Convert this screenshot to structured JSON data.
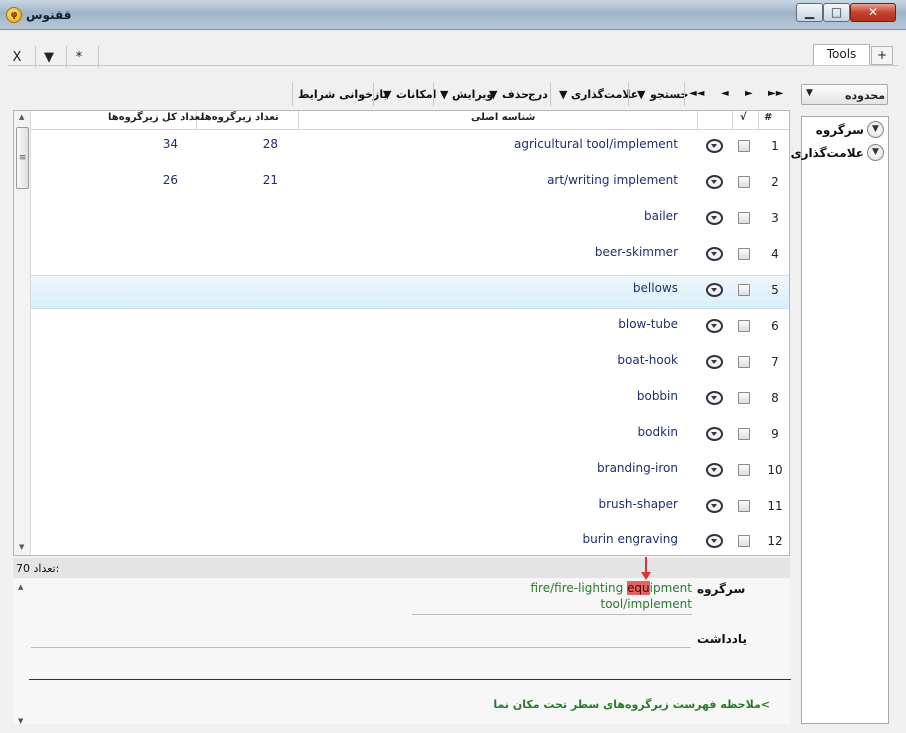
{
  "window": {
    "title": "ققنوس",
    "app_icon": "phoenix-app-icon",
    "buttons": {
      "minimize": "▁",
      "maximize": "□",
      "close": "✕"
    }
  },
  "toolbar_top": {
    "close_label": "X",
    "dropdown_label": "▼",
    "star_label": "*",
    "tabs": [
      {
        "label": "Tools"
      },
      {
        "label": "+"
      }
    ]
  },
  "toolbar_main": {
    "reload_conditions": "بازخوانی شرایط",
    "options": "امکانات",
    "edit": "ویرایش",
    "delete": "حذف",
    "insert": "درج",
    "bookmark": "علامت‌گذاری",
    "search": "جستجو",
    "dropdown_arrow": "▼",
    "nav": {
      "first": "◄◄",
      "prev": "◄",
      "next": "►",
      "last": "►►"
    },
    "scope": {
      "label": "محدوده",
      "arrow": "▼"
    }
  },
  "right_panel": {
    "items": [
      {
        "label": "سرگروه",
        "chevron": "chevron-down-icon"
      },
      {
        "label": "علامت‌گذاری",
        "chevron": "chevron-down-icon"
      }
    ]
  },
  "grid": {
    "headers": {
      "num": "#",
      "check": "√",
      "main_id": "شناسه اصلی",
      "subgroups": "تعداد زیرگروه‌ها",
      "total_subgroups": "تعداد کل زیرگروه‌ها"
    },
    "rows": [
      {
        "num": "1",
        "name": "agricultural tool/implement",
        "subgroups": "28",
        "total": "34"
      },
      {
        "num": "2",
        "name": "art/writing implement",
        "subgroups": "21",
        "total": "26"
      },
      {
        "num": "3",
        "name": "bailer",
        "subgroups": "",
        "total": ""
      },
      {
        "num": "4",
        "name": "beer-skimmer",
        "subgroups": "",
        "total": ""
      },
      {
        "num": "5",
        "name": "bellows",
        "subgroups": "",
        "total": ""
      },
      {
        "num": "6",
        "name": "blow-tube",
        "subgroups": "",
        "total": ""
      },
      {
        "num": "7",
        "name": "boat-hook",
        "subgroups": "",
        "total": ""
      },
      {
        "num": "8",
        "name": "bobbin",
        "subgroups": "",
        "total": ""
      },
      {
        "num": "9",
        "name": "bodkin",
        "subgroups": "",
        "total": ""
      },
      {
        "num": "10",
        "name": "branding-iron",
        "subgroups": "",
        "total": ""
      },
      {
        "num": "11",
        "name": "brush-shaper",
        "subgroups": "",
        "total": ""
      },
      {
        "num": "12",
        "name": "burin engraving",
        "subgroups": "",
        "total": ""
      }
    ],
    "selected_row": 5,
    "scroll": {
      "up": "▲",
      "down": "▼",
      "grip": "≡"
    }
  },
  "status": {
    "count_label": "تعداد:",
    "count_value": "70"
  },
  "detail": {
    "parent_label": "سرگروه",
    "parent_value_pre": "fire/fire-lighting ",
    "parent_value_highlight": "equ",
    "parent_value_post": "ipment",
    "parent_value_line2": "tool/implement",
    "note_label": "یادداشت",
    "view_list_link": ">ملاحظه فهرست زیرگروه‌های سطر تحت مکان نما",
    "scroll": {
      "up": "▲",
      "down": "▼"
    }
  }
}
